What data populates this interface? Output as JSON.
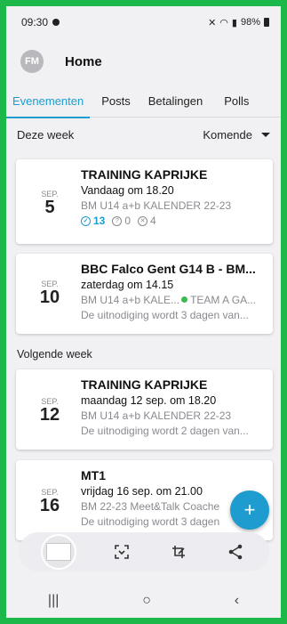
{
  "status": {
    "time": "09:30",
    "battery": "98%"
  },
  "header": {
    "avatar_initials": "FM",
    "title": "Home"
  },
  "tabs": [
    {
      "label": "Evenementen",
      "active": true
    },
    {
      "label": "Posts",
      "active": false
    },
    {
      "label": "Betalingen",
      "active": false
    },
    {
      "label": "Polls",
      "active": false
    }
  ],
  "filter": {
    "period": "Deze week",
    "sort": "Komende"
  },
  "sections": {
    "next_week": "Volgende week"
  },
  "events": [
    {
      "month": "SEP.",
      "day": "5",
      "title": "TRAINING KAPRIJKE",
      "when": "Vandaag om 18.20",
      "calendar": "BM U14 a+b KALENDER 22-23",
      "counts": {
        "yes": "13",
        "maybe": "0",
        "no": "4"
      }
    },
    {
      "month": "SEP.",
      "day": "10",
      "title": "BBC Falco Gent G14 B - BM...",
      "when": "zaterdag om 14.15",
      "calendar": "BM U14 a+b KALE...",
      "team": "TEAM A GA...",
      "note": "De uitnodiging wordt 3 dagen van..."
    },
    {
      "month": "SEP.",
      "day": "12",
      "title": "TRAINING KAPRIJKE",
      "when": "maandag 12 sep. om 18.20",
      "calendar": "BM U14 a+b KALENDER 22-23",
      "note": "De uitnodiging wordt 2 dagen van..."
    },
    {
      "month": "SEP.",
      "day": "16",
      "title": "MT1",
      "when": "vrijdag 16 sep. om 21.00",
      "calendar": "BM 22-23 Meet&Talk Coache",
      "note": "De uitnodiging wordt 3 dagen"
    }
  ],
  "fab": {
    "label": "+"
  },
  "colors": {
    "accent": "#1e9ccf",
    "frame": "#1db84a",
    "team_dot": "#3fb950"
  }
}
